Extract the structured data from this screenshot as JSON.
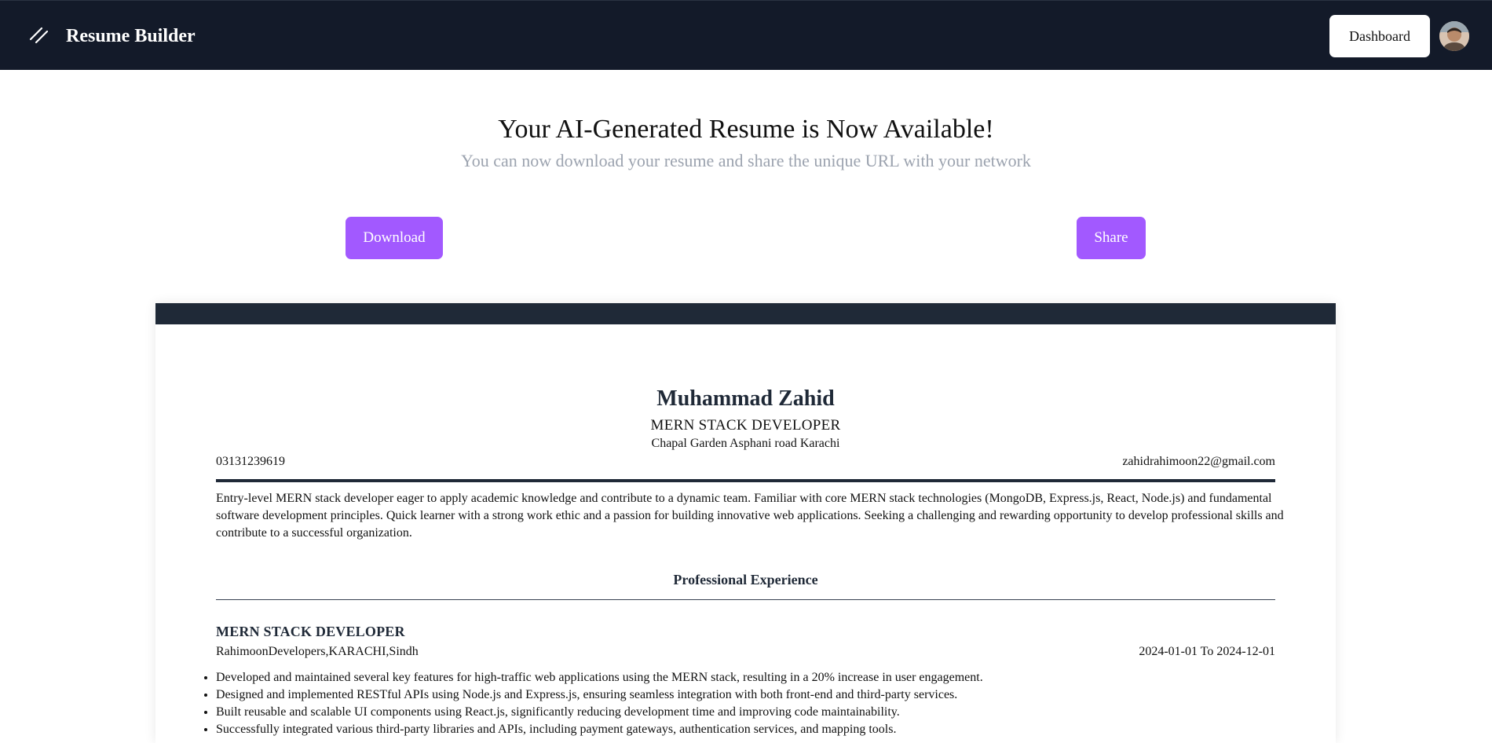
{
  "header": {
    "brand_title": "Resume Builder",
    "dashboard_label": "Dashboard"
  },
  "hero": {
    "title": "Your AI-Generated Resume is Now Available!",
    "subtitle": "You can now download your resume and share the unique URL with your network",
    "download_label": "Download",
    "share_label": "Share"
  },
  "resume": {
    "name": "Muhammad Zahid",
    "title": "MERN STACK DEVELOPER",
    "address": "Chapal Garden Asphani road Karachi",
    "phone": "03131239619",
    "email": "zahidrahimoon22@gmail.com",
    "summary": "Entry-level MERN stack developer eager to apply academic knowledge and contribute to a dynamic team. Familiar with core MERN stack technologies (MongoDB, Express.js, React, Node.js) and fundamental software development principles. Quick learner with a strong work ethic and a passion for building innovative web applications. Seeking a challenging and rewarding opportunity to develop professional skills and contribute to a successful organization.",
    "experience_heading": "Professional Experience",
    "experience": [
      {
        "job_title": "MERN STACK DEVELOPER",
        "company": "RahimoonDevelopers,KARACHI,Sindh",
        "dates": "2024-01-01 To 2024-12-01",
        "bullets": [
          " Developed and maintained several key features for high-traffic web applications using the MERN stack, resulting in a 20% increase in user engagement.",
          "Designed and implemented RESTful APIs using Node.js and Express.js, ensuring seamless integration with both front-end and third-party services.",
          "Built reusable and scalable UI components using React.js, significantly reducing development time and improving code maintainability.",
          "Successfully integrated various third-party libraries and APIs, including payment gateways, authentication services, and mapping tools."
        ]
      }
    ]
  },
  "colors": {
    "navbar": "#131a29",
    "accent": "#a259ff",
    "resume_bar": "#1f2937",
    "subtitle": "#9ca3af"
  },
  "icons": {
    "brand": "slash-logo-icon",
    "avatar": "user-avatar"
  }
}
